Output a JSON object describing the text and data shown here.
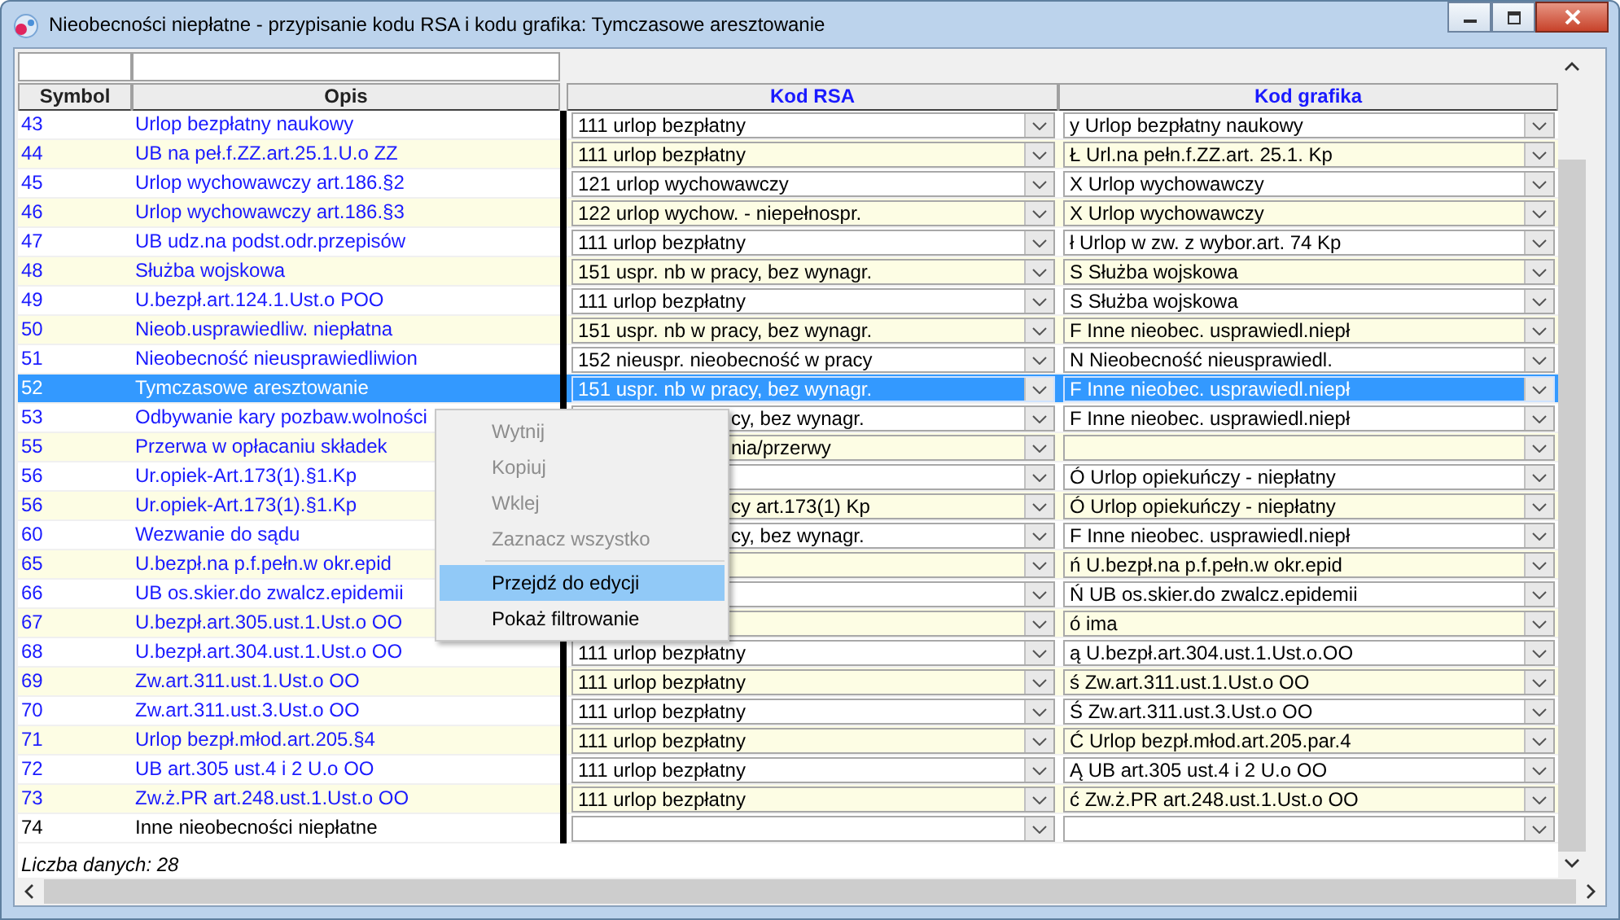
{
  "window": {
    "title": "Nieobecności niepłatne -  przypisanie kodu RSA i kodu grafika: Tymczasowe aresztowanie"
  },
  "table": {
    "columns": [
      "Symbol",
      "Opis",
      "Kod RSA",
      "Kod grafika"
    ],
    "rows": [
      {
        "symbol": "43",
        "opis": "Urlop bezpłatny naukowy",
        "rsa": "111 urlop bezpłatny",
        "rsa_covered": false,
        "grafik": "y Urlop bezpłatny naukowy",
        "color": "#1a1aff",
        "selected": false
      },
      {
        "symbol": "44",
        "opis": "UB na peł.f.ZZ.art.25.1.U.o ZZ",
        "rsa": "111 urlop bezpłatny",
        "rsa_covered": false,
        "grafik": "Ł Url.na pełn.f.ZZ.art. 25.1. Kp",
        "color": "#1a1aff",
        "selected": false
      },
      {
        "symbol": "45",
        "opis": "Urlop wychowawczy art.186.§2",
        "rsa": "121 urlop wychowawczy",
        "rsa_covered": false,
        "grafik": "X Urlop wychowawczy",
        "color": "#1a1aff",
        "selected": false
      },
      {
        "symbol": "46",
        "opis": "Urlop wychowawczy art.186.§3",
        "rsa": "122 urlop wychow. - niepełnospr.",
        "rsa_covered": false,
        "grafik": "X Urlop wychowawczy",
        "color": "#1a1aff",
        "selected": false
      },
      {
        "symbol": "47",
        "opis": "UB udz.na podst.odr.przepisów",
        "rsa": "111 urlop bezpłatny",
        "rsa_covered": false,
        "grafik": "ł Urlop w zw. z wybor.art. 74 Kp",
        "color": "#1a1aff",
        "selected": false
      },
      {
        "symbol": "48",
        "opis": "Służba wojskowa",
        "rsa": "151 uspr. nb w pracy, bez wynagr.",
        "rsa_covered": false,
        "grafik": "S Służba wojskowa",
        "color": "#1a1aff",
        "selected": false
      },
      {
        "symbol": "49",
        "opis": "U.bezpł.art.124.1.Ust.o POO",
        "rsa": "111 urlop bezpłatny",
        "rsa_covered": false,
        "grafik": "S Służba wojskowa",
        "color": "#1a1aff",
        "selected": false
      },
      {
        "symbol": "50",
        "opis": "Nieob.usprawiedliw. niepłatna",
        "rsa": "151 uspr. nb w pracy, bez wynagr.",
        "rsa_covered": false,
        "grafik": "F Inne nieobec. usprawiedl.niepł",
        "color": "#1a1aff",
        "selected": false
      },
      {
        "symbol": "51",
        "opis": "Nieobecność nieusprawiedliwion",
        "rsa": "152 nieuspr. nieobecność w pracy",
        "rsa_covered": false,
        "grafik": "N Nieobecność nieusprawiedl.",
        "color": "#1a1aff",
        "selected": false
      },
      {
        "symbol": "52",
        "opis": "Tymczasowe aresztowanie",
        "rsa": "151 uspr. nb w pracy, bez wynagr.",
        "rsa_covered": false,
        "grafik": "F Inne nieobec. usprawiedl.niepł",
        "selected": true
      },
      {
        "symbol": "53",
        "opis": "Odbywanie kary pozbaw.wolności",
        "rsa": "cy, bez wynagr.",
        "rsa_covered": true,
        "grafik": "F Inne nieobec. usprawiedl.niepł",
        "color": "#1a1aff",
        "selected": false
      },
      {
        "symbol": "55",
        "opis": "Przerwa w opłacaniu składek",
        "rsa": "nia/przerwy",
        "rsa_covered": true,
        "color": "#1a1aff",
        "selected": false
      },
      {
        "symbol": "56",
        "opis": "Ur.opiek-Art.173(1).§1.Kp",
        "grafik": "Ó Urlop opiekuńczy - niepłatny",
        "color": "#1a1aff",
        "selected": false
      },
      {
        "symbol": "56",
        "opis": "Ur.opiek-Art.173(1).§1.Kp",
        "rsa": "cy art.173(1) Kp",
        "rsa_covered": true,
        "grafik": "Ó Urlop opiekuńczy - niepłatny",
        "color": "#1a1aff",
        "selected": false
      },
      {
        "symbol": "60",
        "opis": "Wezwanie do sądu",
        "rsa": "cy, bez wynagr.",
        "rsa_covered": true,
        "grafik": "F Inne nieobec. usprawiedl.niepł",
        "color": "#1a1aff",
        "selected": false
      },
      {
        "symbol": "65",
        "opis": "U.bezpł.na p.f.pełn.w okr.epid",
        "grafik": "ń U.bezpł.na p.f.pełn.w okr.epid",
        "color": "#1a1aff",
        "selected": false
      },
      {
        "symbol": "66",
        "opis": "UB os.skier.do zwalcz.epidemii",
        "grafik": "Ń UB os.skier.do zwalcz.epidemii",
        "color": "#1a1aff",
        "selected": false
      },
      {
        "symbol": "67",
        "opis": "U.bezpł.art.305.ust.1.Ust.o OO",
        "grafik": "ó ima",
        "color": "#1a1aff",
        "selected": false
      },
      {
        "symbol": "68",
        "opis": "U.bezpł.art.304.ust.1.Ust.o OO",
        "rsa": "111 urlop bezpłatny",
        "rsa_covered": false,
        "grafik": "ą U.bezpł.art.304.ust.1.Ust.o.OO",
        "color": "#1a1aff",
        "selected": false
      },
      {
        "symbol": "69",
        "opis": "Zw.art.311.ust.1.Ust.o OO",
        "rsa": "111 urlop bezpłatny",
        "rsa_covered": false,
        "grafik": "ś Zw.art.311.ust.1.Ust.o OO",
        "color": "#1a1aff",
        "selected": false
      },
      {
        "symbol": "70",
        "opis": "Zw.art.311.ust.3.Ust.o OO",
        "rsa": "111 urlop bezpłatny",
        "rsa_covered": false,
        "grafik": "Ś Zw.art.311.ust.3.Ust.o OO",
        "color": "#1a1aff",
        "selected": false
      },
      {
        "symbol": "71",
        "opis": "Urlop bezpł.młod.art.205.§4",
        "rsa": "111 urlop bezpłatny",
        "rsa_covered": false,
        "grafik": "Ć Urlop bezpł.młod.art.205.par.4",
        "color": "#1a1aff",
        "selected": false
      },
      {
        "symbol": "72",
        "opis": "UB art.305 ust.4 i 2 U.o OO",
        "rsa": "111 urlop bezpłatny",
        "rsa_covered": false,
        "grafik": "Ą UB art.305 ust.4 i 2 U.o OO",
        "color": "#1a1aff",
        "selected": false
      },
      {
        "symbol": "73",
        "opis": "Zw.ż.PR art.248.ust.1.Ust.o OO",
        "rsa": "111 urlop bezpłatny",
        "rsa_covered": false,
        "grafik": "ć Zw.ż.PR art.248.ust.1.Ust.o OO",
        "color": "#1a1aff",
        "selected": false
      },
      {
        "symbol": "74",
        "opis": "Inne nieobecności niepłatne",
        "color": "#000000",
        "selected": false
      }
    ]
  },
  "footer": "Liczba danych: 28",
  "context_menu": [
    {
      "kind": "item",
      "label": "Wytnij",
      "disabled": true,
      "selected": false
    },
    {
      "kind": "item",
      "label": "Kopiuj",
      "disabled": true,
      "selected": false
    },
    {
      "kind": "item",
      "label": "Wklej",
      "disabled": true,
      "selected": false
    },
    {
      "kind": "item",
      "label": "Zaznacz wszystko",
      "disabled": true,
      "selected": false
    },
    {
      "kind": "separator"
    },
    {
      "kind": "item",
      "label": "Przejdź do edycji",
      "disabled": false,
      "selected": true
    },
    {
      "kind": "item",
      "label": "Pokaż filtrowanie",
      "disabled": false,
      "selected": false
    }
  ]
}
